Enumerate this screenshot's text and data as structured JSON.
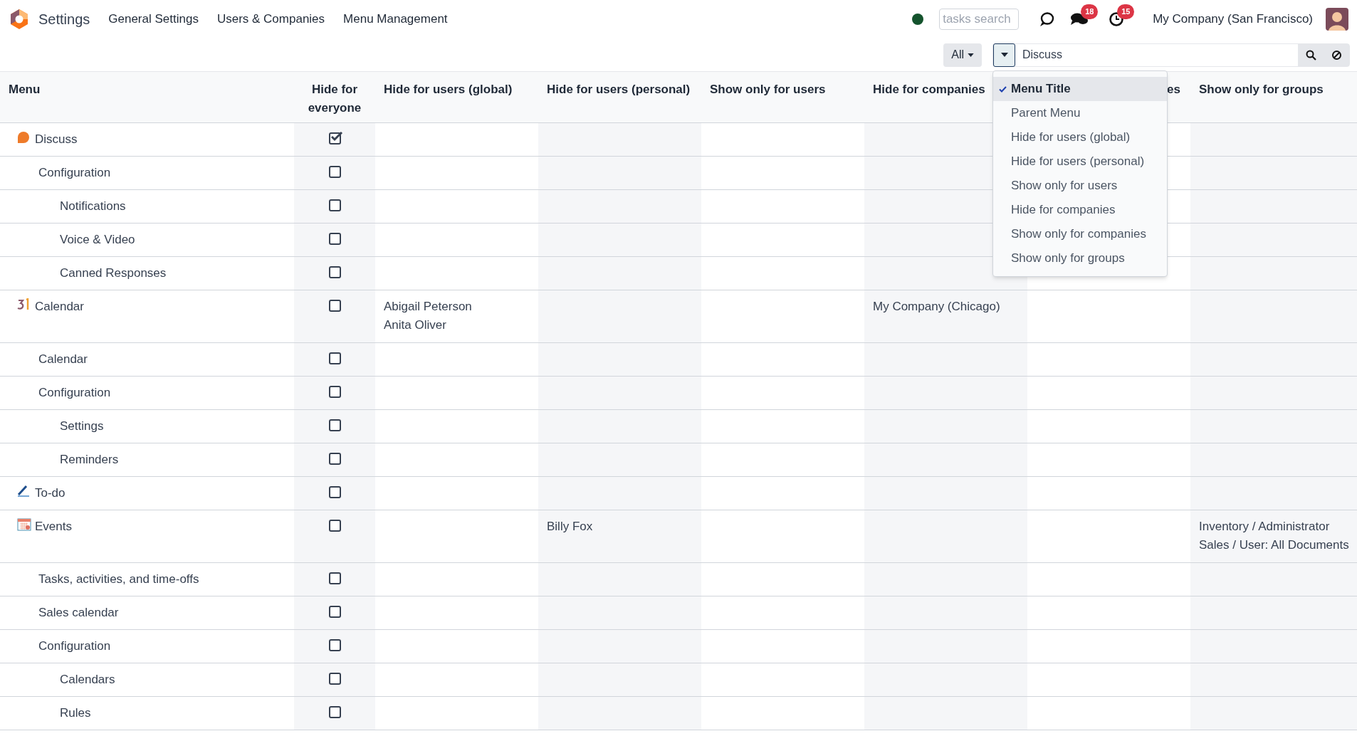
{
  "navbar": {
    "app_name": "Settings",
    "menu": [
      "General Settings",
      "Users & Companies",
      "Menu Management"
    ],
    "tasks_search": {
      "placeholder": "tasks search"
    },
    "messages_badge": "18",
    "activities_badge": "15",
    "company": "My Company (San Francisco)"
  },
  "search": {
    "filter_button": "All",
    "value": "Discuss",
    "field_menu": [
      {
        "label": "Menu Title",
        "selected": true
      },
      {
        "label": "Parent Menu",
        "selected": false
      },
      {
        "label": "Hide for users (global)",
        "selected": false
      },
      {
        "label": "Hide for users (personal)",
        "selected": false
      },
      {
        "label": "Show only for users",
        "selected": false
      },
      {
        "label": "Hide for companies",
        "selected": false
      },
      {
        "label": "Show only for companies",
        "selected": false
      },
      {
        "label": "Show only for groups",
        "selected": false
      }
    ]
  },
  "table": {
    "columns": [
      "Menu",
      "Hide for everyone",
      "Hide for users (global)",
      "Hide for users (personal)",
      "Show only for users",
      "Hide for companies",
      "es",
      "Show only for groups"
    ],
    "rows": [
      {
        "title": "Discuss",
        "hide_everyone": true,
        "children": [
          {
            "title": "Configuration",
            "hide_everyone": false,
            "children": [
              {
                "title": "Notifications",
                "hide_everyone": false
              },
              {
                "title": "Voice & Video",
                "hide_everyone": false
              },
              {
                "title": "Canned Responses",
                "hide_everyone": false
              }
            ]
          }
        ]
      },
      {
        "title": "Calendar",
        "hide_everyone": false,
        "hide_global": [
          "Abigail Peterson",
          "Anita Oliver"
        ],
        "hide_companies": [
          "My Company (Chicago)"
        ],
        "children": [
          {
            "title": "Calendar",
            "hide_everyone": false
          },
          {
            "title": "Configuration",
            "hide_everyone": false,
            "children": [
              {
                "title": "Settings",
                "hide_everyone": false
              },
              {
                "title": "Reminders",
                "hide_everyone": false
              }
            ]
          }
        ]
      },
      {
        "title": "To-do",
        "hide_everyone": false
      },
      {
        "title": "Events",
        "hide_everyone": false,
        "hide_personal": [
          "Billy Fox"
        ],
        "show_groups": [
          "Inventory / Administrator",
          "Sales / User: All Documents"
        ],
        "children": [
          {
            "title": "Tasks, activities, and time-offs",
            "hide_everyone": false
          },
          {
            "title": "Sales calendar",
            "hide_everyone": false
          },
          {
            "title": "Configuration",
            "hide_everyone": false,
            "children": [
              {
                "title": "Calendars",
                "hide_everyone": false
              },
              {
                "title": "Rules",
                "hide_everyone": false
              }
            ]
          }
        ]
      }
    ]
  }
}
